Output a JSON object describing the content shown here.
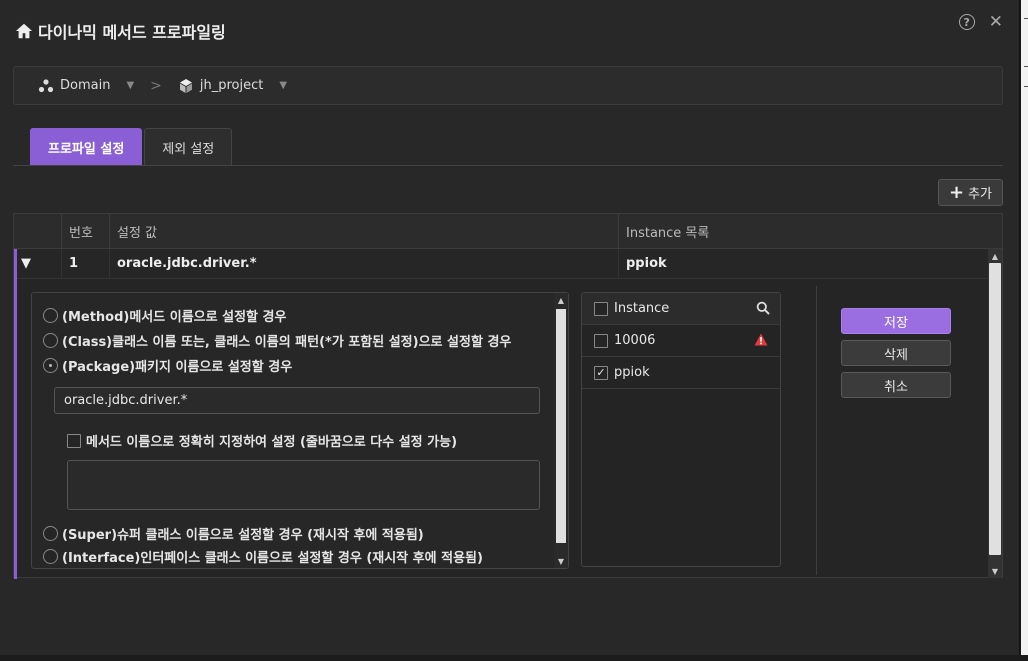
{
  "dialog": {
    "title": "다이나믹 메서드 프로파일링",
    "help_label": "?",
    "close_label": "✕"
  },
  "breadcrumb": {
    "domain_label": "Domain",
    "separator": ">",
    "project_label": "jh_project"
  },
  "tabs": [
    {
      "label": "프로파일 설정",
      "active": true
    },
    {
      "label": "제외 설정",
      "active": false
    }
  ],
  "toolbar": {
    "add_label": "추가"
  },
  "grid": {
    "columns": [
      "",
      "번호",
      "설정 값",
      "Instance 목록"
    ],
    "rows": [
      {
        "expanded": true,
        "number": "1",
        "value": "oracle.jdbc.driver.*",
        "instances": "ppiok"
      }
    ]
  },
  "options": {
    "items": [
      {
        "label": "(Method)메서드 이름으로 설정할 경우",
        "selected": false
      },
      {
        "label": "(Class)클래스 이름 또는, 클래스 이름의 패턴(*가 포함된 설정)으로 설정할 경우",
        "selected": false
      },
      {
        "label": "(Package)패키지 이름으로 설정할 경우",
        "selected": true
      },
      {
        "label": "(Super)슈퍼 클래스 이름으로 설정할 경우 (재시작 후에 적용됨)",
        "selected": false
      },
      {
        "label": "(Interface)인터페이스 클래스 이름으로 설정할 경우 (재시작 후에 적용됨)",
        "selected": false
      }
    ],
    "package_value": "oracle.jdbc.driver.*",
    "method_checkbox_label": "메서드 이름으로 정확히 지정하여 설정 (줄바꿈으로 다수 설정 가능)",
    "method_checked": false,
    "method_textarea": ""
  },
  "instances": {
    "header": "Instance",
    "items": [
      {
        "name": "10006",
        "checked": false,
        "warning": true
      },
      {
        "name": "ppiok",
        "checked": true,
        "warning": false
      }
    ]
  },
  "actions": {
    "save_label": "저장",
    "delete_label": "삭제",
    "cancel_label": "취소"
  },
  "colors": {
    "accent": "#8a5fd6",
    "warning": "#e03b3b",
    "background": "#282828"
  }
}
